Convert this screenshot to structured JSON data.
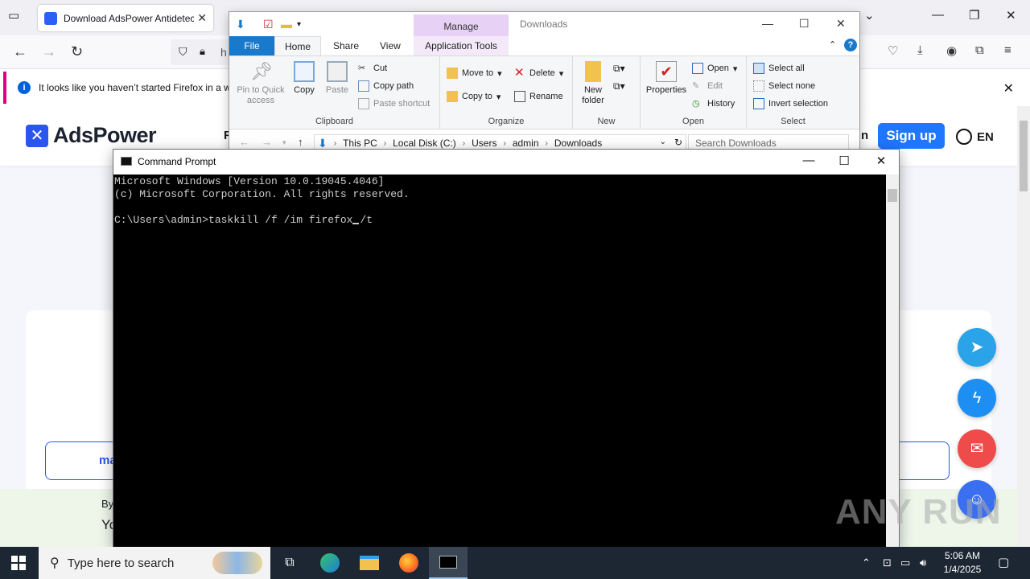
{
  "firefox": {
    "tab_title": "Download AdsPower Antidetect",
    "url_fragment": "h",
    "notification": "It looks like you haven’t started Firefox in a wh",
    "site": {
      "logo_text": "AdsPower",
      "header_left_fragment": "F",
      "header_right_fragment": "n",
      "signup_label": "Sign up",
      "lang_label": "EN",
      "outline_button_fragment": "ma",
      "by_text": "By",
      "yo_text": "Yo"
    }
  },
  "explorer": {
    "window_title": "Downloads",
    "manage_tab": "Manage",
    "tabs": {
      "file": "File",
      "home": "Home",
      "share": "Share",
      "view": "View",
      "app_tools": "Application Tools"
    },
    "clipboard": {
      "group": "Clipboard",
      "pin": "Pin to Quick access",
      "copy": "Copy",
      "paste": "Paste",
      "cut": "Cut",
      "copy_path": "Copy path",
      "paste_shortcut": "Paste shortcut"
    },
    "organize": {
      "group": "Organize",
      "move_to": "Move to",
      "copy_to": "Copy to",
      "delete": "Delete",
      "rename": "Rename"
    },
    "new": {
      "group": "New",
      "new_folder": "New folder"
    },
    "open": {
      "group": "Open",
      "properties": "Properties",
      "open": "Open",
      "edit": "Edit",
      "history": "History"
    },
    "select": {
      "group": "Select",
      "select_all": "Select all",
      "select_none": "Select none",
      "invert": "Invert selection"
    },
    "path": [
      "This PC",
      "Local Disk (C:)",
      "Users",
      "admin",
      "Downloads"
    ],
    "search_placeholder": "Search Downloads"
  },
  "cmd": {
    "title": "Command Prompt",
    "line1": "Microsoft Windows [Version 10.0.19045.4046]",
    "line2": "(c) Microsoft Corporation. All rights reserved.",
    "prompt": "C:\\Users\\admin>",
    "command_before_cursor": "taskkill /f /im firefox",
    "command_after_cursor": "/t"
  },
  "watermark": "ANY RUN",
  "taskbar": {
    "search_placeholder": "Type here to search",
    "time": "5:06 AM",
    "date": "1/4/2025"
  },
  "colors": {
    "accent_blue": "#1979ca",
    "adspower_blue": "#2b56ee",
    "signup_blue": "#1f77ff",
    "telegram": "#2aa3e8",
    "messenger": "#1d8ff2",
    "email": "#ef4b4b",
    "chat": "#3a6ff0"
  }
}
